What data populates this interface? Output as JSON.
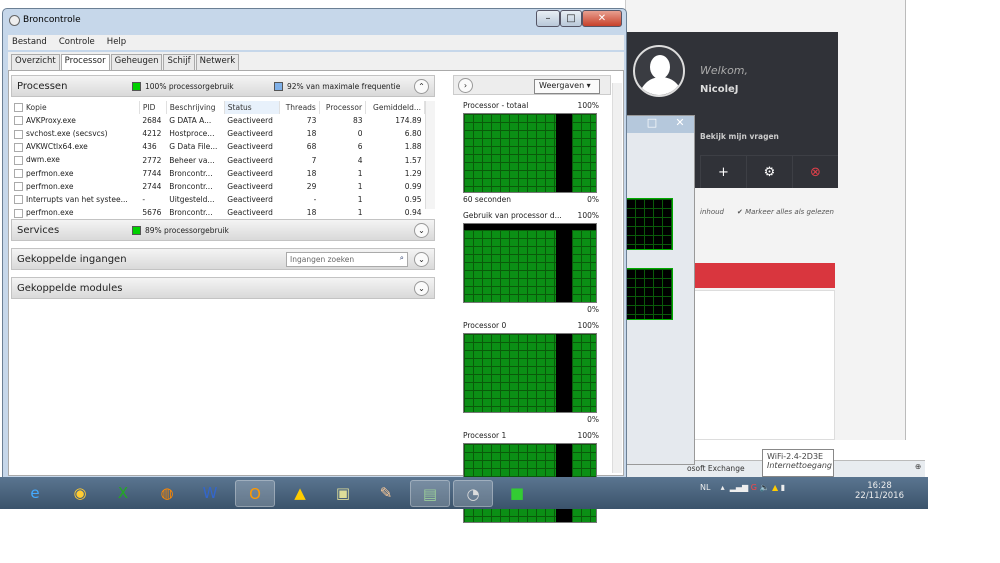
{
  "window": {
    "title": "Broncontrole",
    "minimize": "–",
    "maximize": "□",
    "close": "✕"
  },
  "menu": [
    "Bestand",
    "Controle",
    "Help"
  ],
  "tabs": [
    "Overzicht",
    "Processor",
    "Geheugen",
    "Schijf",
    "Netwerk"
  ],
  "processes": {
    "title": "Processen",
    "cpu_usage": "100% processorgebruik",
    "freq": "92% van maximale frequentie",
    "columns": [
      "Kopie",
      "PID",
      "Beschrijving",
      "Status",
      "Threads",
      "Processor",
      "Gemiddeld..."
    ],
    "rows": [
      [
        "AVKProxy.exe",
        "2684",
        "G DATA A...",
        "Geactiveerd",
        "73",
        "83",
        "174.89"
      ],
      [
        "svchost.exe (secsvcs)",
        "4212",
        "Hostproce...",
        "Geactiveerd",
        "18",
        "0",
        "6.80"
      ],
      [
        "AVKWCtlx64.exe",
        "436",
        "G Data File...",
        "Geactiveerd",
        "68",
        "6",
        "1.88"
      ],
      [
        "dwm.exe",
        "2772",
        "Beheer va...",
        "Geactiveerd",
        "7",
        "4",
        "1.57"
      ],
      [
        "perfmon.exe",
        "7744",
        "Broncontr...",
        "Geactiveerd",
        "18",
        "1",
        "1.29"
      ],
      [
        "perfmon.exe",
        "2744",
        "Broncontr...",
        "Geactiveerd",
        "29",
        "1",
        "0.99"
      ],
      [
        "Interrupts van het systee...",
        "-",
        "Uitgesteld...",
        "Geactiveerd",
        "-",
        "1",
        "0.95"
      ],
      [
        "perfmon.exe",
        "5676",
        "Broncontr...",
        "Geactiveerd",
        "18",
        "1",
        "0.94"
      ]
    ]
  },
  "services": {
    "title": "Services",
    "usage": "89% processorgebruik"
  },
  "handles": {
    "title": "Gekoppelde ingangen",
    "search_placeholder": "Ingangen zoeken"
  },
  "modules": {
    "title": "Gekoppelde modules"
  },
  "graphs": {
    "view_button": "Weergaven",
    "items": [
      {
        "title": "Processor - totaal",
        "max": "100%",
        "min": "0%",
        "footer": "60 seconden",
        "fill": 100
      },
      {
        "title": "Gebruik van processor d...",
        "max": "100%",
        "min": "0%",
        "footer": "",
        "fill": 92
      },
      {
        "title": "Processor 0",
        "max": "100%",
        "min": "0%",
        "footer": "",
        "fill": 100
      },
      {
        "title": "Processor 1",
        "max": "100%",
        "min": "",
        "footer": "",
        "fill": 100
      }
    ]
  },
  "background_page": {
    "welcome": "Welkom,",
    "user": "NicoleJ",
    "questions": "Bekijk mijn vragen",
    "contents": "inhoud",
    "mark_read": "Markeer alles als gelezen",
    "status_exchange": "osoft Exchange"
  },
  "wifi_tooltip": {
    "name": "WiFi-2.4-2D3E",
    "status": "Internettoegang"
  },
  "taskbar": {
    "language": "NL",
    "time": "16:28",
    "date": "22/11/2016"
  },
  "colors": {
    "cpu": "#00c000",
    "freq": "#6fa8dc",
    "graph": "#0b8f15"
  }
}
